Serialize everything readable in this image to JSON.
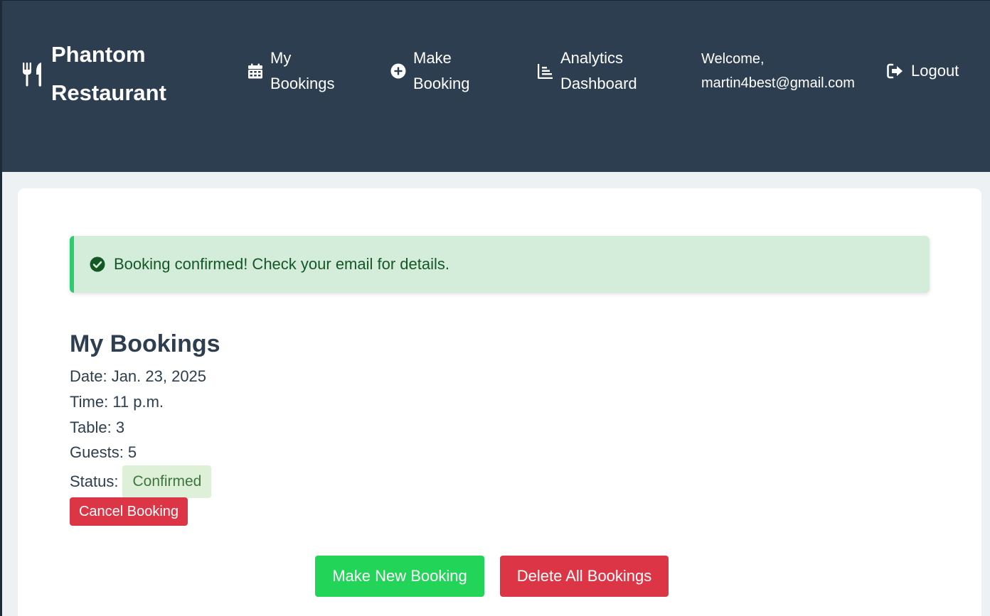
{
  "brand": {
    "name": "Phantom Restaurant",
    "icon": "utensils-icon"
  },
  "nav": {
    "items": [
      {
        "id": "my-bookings",
        "label": "My Bookings",
        "icon": "calendar-icon"
      },
      {
        "id": "make-booking",
        "label": "Make Booking",
        "icon": "plus-circle-icon"
      },
      {
        "id": "analytics",
        "label": "Analytics Dashboard",
        "icon": "chart-icon"
      }
    ],
    "welcome": "Welcome, martin4best@gmail.com",
    "logout": {
      "label": "Logout",
      "icon": "sign-out-icon"
    }
  },
  "alert": {
    "message": "Booking confirmed! Check your email for details.",
    "icon": "check-circle-icon"
  },
  "bookings": {
    "title": "My Bookings",
    "date": "Date: Jan. 23, 2025",
    "time": "Time: 11 p.m.",
    "table": "Table: 3",
    "guests": "Guests: 5",
    "status_label": "Status:",
    "status_value": "Confirmed",
    "cancel_label": "Cancel Booking"
  },
  "actions": {
    "new_booking_label": "Make New Booking",
    "delete_all_label": "Delete All Bookings"
  },
  "colors": {
    "navbar": "#2c3e50",
    "success_bg": "#d4edda",
    "success_text": "#155724",
    "danger": "#dc3545",
    "primary_green": "#22d457"
  }
}
